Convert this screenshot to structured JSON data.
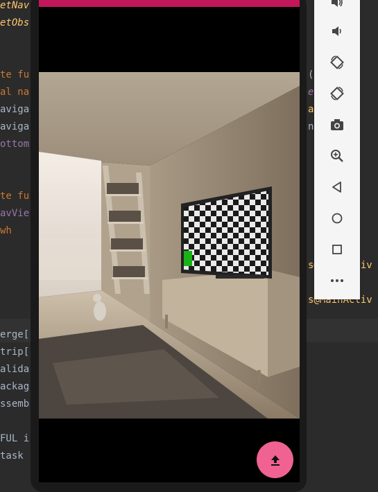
{
  "ide_left_code": [
    {
      "text": "etNav",
      "color": "#ffc66d",
      "italic": true
    },
    {
      "text": "etObs",
      "color": "#ffc66d",
      "italic": true
    },
    {
      "text": "",
      "color": "#a9b7c6",
      "italic": false
    },
    {
      "text": "",
      "color": "#a9b7c6",
      "italic": false
    },
    {
      "text": "te fu",
      "color": "#cc7832",
      "italic": false
    },
    {
      "text": "al na",
      "color": "#cc7832",
      "italic": false
    },
    {
      "text": "aviga",
      "color": "#a9b7c6",
      "italic": false
    },
    {
      "text": "aviga",
      "color": "#a9b7c6",
      "italic": false
    },
    {
      "text": "ottom",
      "color": "#9876aa",
      "italic": false
    },
    {
      "text": "",
      "color": "#a9b7c6",
      "italic": false
    },
    {
      "text": "",
      "color": "#a9b7c6",
      "italic": false
    },
    {
      "text": "te fu",
      "color": "#cc7832",
      "italic": false
    },
    {
      "text": "avVie",
      "color": "#9876aa",
      "italic": false
    },
    {
      "text": "   wh",
      "color": "#cc7832",
      "italic": false
    },
    {
      "text": "",
      "color": "#a9b7c6",
      "italic": false
    },
    {
      "text": "",
      "color": "#a9b7c6",
      "italic": false
    },
    {
      "text": "",
      "color": "#a9b7c6",
      "italic": false
    },
    {
      "text": "",
      "color": "#a9b7c6",
      "italic": false
    },
    {
      "text": "",
      "color": "#a9b7c6",
      "italic": false
    },
    {
      "text": "erge[",
      "color": "#a9b7c6",
      "italic": false
    },
    {
      "text": "trip[",
      "color": "#a9b7c6",
      "italic": false
    },
    {
      "text": "alida",
      "color": "#a9b7c6",
      "italic": false
    },
    {
      "text": "ackag",
      "color": "#a9b7c6",
      "italic": false
    },
    {
      "text": "ssemb",
      "color": "#a9b7c6",
      "italic": false
    },
    {
      "text": "",
      "color": "#a9b7c6",
      "italic": false
    },
    {
      "text": "FUL i",
      "color": "#a9b7c6",
      "italic": false
    },
    {
      "text": " task",
      "color": "#a9b7c6",
      "italic": false
    }
  ],
  "ide_right_code": [
    {
      "text": "",
      "color": "#a9b7c6",
      "italic": false
    },
    {
      "text": "",
      "color": "#a9b7c6",
      "italic": false
    },
    {
      "text": "",
      "color": "#a9b7c6",
      "italic": false
    },
    {
      "text": "",
      "color": "#a9b7c6",
      "italic": false
    },
    {
      "text": "(",
      "color": "#a9b7c6",
      "italic": false
    },
    {
      "text": "   ent)",
      "color": "#9876aa",
      "italic": true
    },
    {
      "text": "   ain",
      "color": "#ffc66d",
      "italic": false
    },
    {
      "text": "   navC",
      "color": "#a9b7c6",
      "italic": false
    },
    {
      "text": "",
      "color": "#a9b7c6",
      "italic": false
    },
    {
      "text": "",
      "color": "#a9b7c6",
      "italic": false
    },
    {
      "text": "",
      "color": "#a9b7c6",
      "italic": false
    },
    {
      "text": "",
      "color": "#a9b7c6",
      "italic": false
    },
    {
      "text": "",
      "color": "#a9b7c6",
      "italic": false
    },
    {
      "text": "",
      "color": "#a9b7c6",
      "italic": false
    },
    {
      "text": "",
      "color": "#a9b7c6",
      "italic": false
    },
    {
      "text": "s@MainActiv",
      "color": "#ffc66d",
      "italic": false
    },
    {
      "text": "",
      "color": "#a9b7c6",
      "italic": false
    },
    {
      "text": "s@MainActiv",
      "color": "#ffc66d",
      "italic": false
    }
  ],
  "toolbar": {
    "buttons": [
      {
        "name": "volume-down-icon-top",
        "icon": "volume-up"
      },
      {
        "name": "volume-down-button",
        "icon": "volume-down"
      },
      {
        "name": "rotate-left-button",
        "icon": "rotate-left"
      },
      {
        "name": "rotate-right-button",
        "icon": "rotate-right"
      },
      {
        "name": "screenshot-button",
        "icon": "camera"
      },
      {
        "name": "zoom-button",
        "icon": "zoom"
      },
      {
        "name": "back-button",
        "icon": "back"
      },
      {
        "name": "home-button",
        "icon": "home"
      },
      {
        "name": "overview-button",
        "icon": "overview"
      },
      {
        "name": "more-button",
        "icon": "more"
      }
    ]
  },
  "app": {
    "appbar_color": "#c2185b",
    "fab_color": "#f06292",
    "fab_icon": "upload-icon"
  }
}
